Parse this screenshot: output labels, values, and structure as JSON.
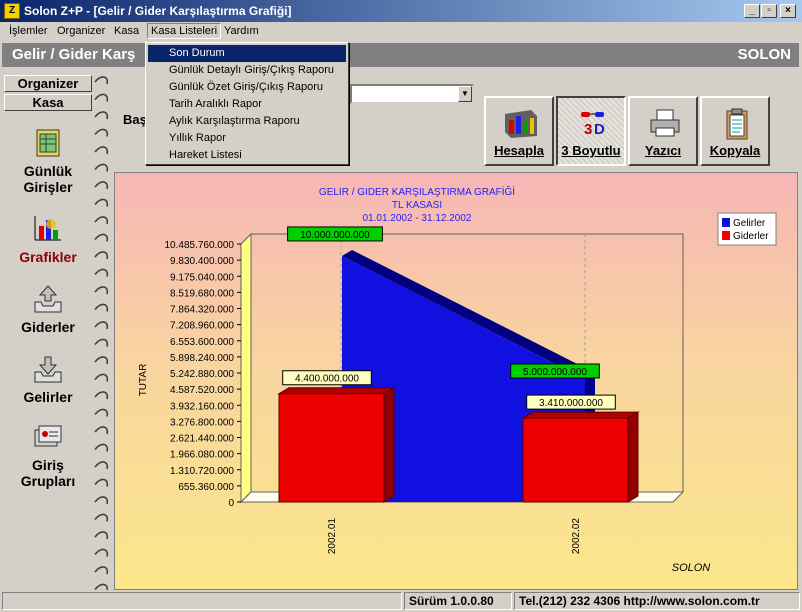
{
  "window": {
    "title": "Solon Z+P - [Gelir / Gider Karşılaştırma Grafiği]",
    "icon": "app-icon",
    "controls": {
      "minimize": "_",
      "restore": "▫",
      "close": "×"
    }
  },
  "menubar": [
    {
      "label": "İşlemler"
    },
    {
      "label": "Organizer"
    },
    {
      "label": "Kasa"
    },
    {
      "label": "Kasa Listeleri",
      "open": true
    },
    {
      "label": "Yardım"
    }
  ],
  "dropdown": {
    "items": [
      {
        "label": "Son Durum",
        "selected": true
      },
      {
        "label": "Günlük Detaylı Giriş/Çıkış Raporu"
      },
      {
        "label": "Günlük Özet Giriş/Çıkış Raporu"
      },
      {
        "label": "Tarih Aralıklı Rapor"
      },
      {
        "label": "Aylık Karşılaştırma Raporu"
      },
      {
        "label": "Yıllık Rapor"
      },
      {
        "label": "Hareket Listesi"
      }
    ]
  },
  "mdi": {
    "title": "Gelir / Gider Karş",
    "brand": "SOLON"
  },
  "sidebar": {
    "tabs": [
      {
        "label": "Organizer"
      },
      {
        "label": "Kasa"
      }
    ],
    "buttons": [
      {
        "label_line1": "Günlük",
        "label_line2": "Girişler",
        "icon": "ledger-icon"
      },
      {
        "label_line1": "Grafikler",
        "label_line2": "",
        "icon": "chart-icon",
        "active": true
      },
      {
        "label_line1": "Giderler",
        "label_line2": "",
        "icon": "outbox-icon"
      },
      {
        "label_line1": "Gelirler",
        "label_line2": "",
        "icon": "inbox-icon"
      },
      {
        "label_line1": "Giriş",
        "label_line2": "Grupları",
        "icon": "group-icon"
      }
    ]
  },
  "toolbar": {
    "bas_label": "Baş",
    "combo_value": "",
    "buttons": [
      {
        "label": "Hesapla",
        "underline": "H",
        "icon": "calculate-icon"
      },
      {
        "label": "3 Boyutlu",
        "underline": "B",
        "icon": "3d-glasses-icon",
        "pressed": true
      },
      {
        "label": "Yazıcı",
        "underline": "Y",
        "icon": "printer-icon"
      },
      {
        "label": "Kopyala",
        "underline": "K",
        "icon": "clipboard-icon"
      }
    ]
  },
  "chart_data": {
    "type": "bar",
    "title": "GELIR / GIDER KARŞILAŞTIRMA GRAFİĞİ",
    "subtitle": "TL KASASI",
    "period": "01.01.2002 - 31.12.2002",
    "ylabel": "TUTAR",
    "xlabel": "",
    "watermark": "SOLON",
    "categories": [
      "2002.01",
      "2002.02"
    ],
    "ylim": [
      0,
      10485760000
    ],
    "yticks": [
      "0",
      "655.360.000",
      "1.310.720.000",
      "1.966.080.000",
      "2.621.440.000",
      "3.276.800.000",
      "3.932.160.000",
      "4.587.520.000",
      "5.242.880.000",
      "5.898.240.000",
      "6.553.600.000",
      "7.208.960.000",
      "7.864.320.000",
      "8.519.680.000",
      "9.175.040.000",
      "9.830.400.000",
      "10.485.760.000"
    ],
    "series": [
      {
        "name": "Gelirler",
        "chart": "area",
        "color": "#1010e0",
        "values": [
          10000000000,
          5000000000
        ],
        "labels": [
          "10.000.000.000",
          "5.000.000.000"
        ],
        "label_bg": "#00d000"
      },
      {
        "name": "Giderler",
        "chart": "bar",
        "color": "#ee0000",
        "values": [
          4400000000,
          3410000000
        ],
        "labels": [
          "4.400.000.000",
          "3.410.000.000"
        ],
        "label_bg": "#ffffc0"
      }
    ],
    "legend": "top-right",
    "grid": true
  },
  "statusbar": {
    "version": "Sürüm 1.0.0.80",
    "contact": "Tel.(212) 232 4306  http://www.solon.com.tr"
  }
}
